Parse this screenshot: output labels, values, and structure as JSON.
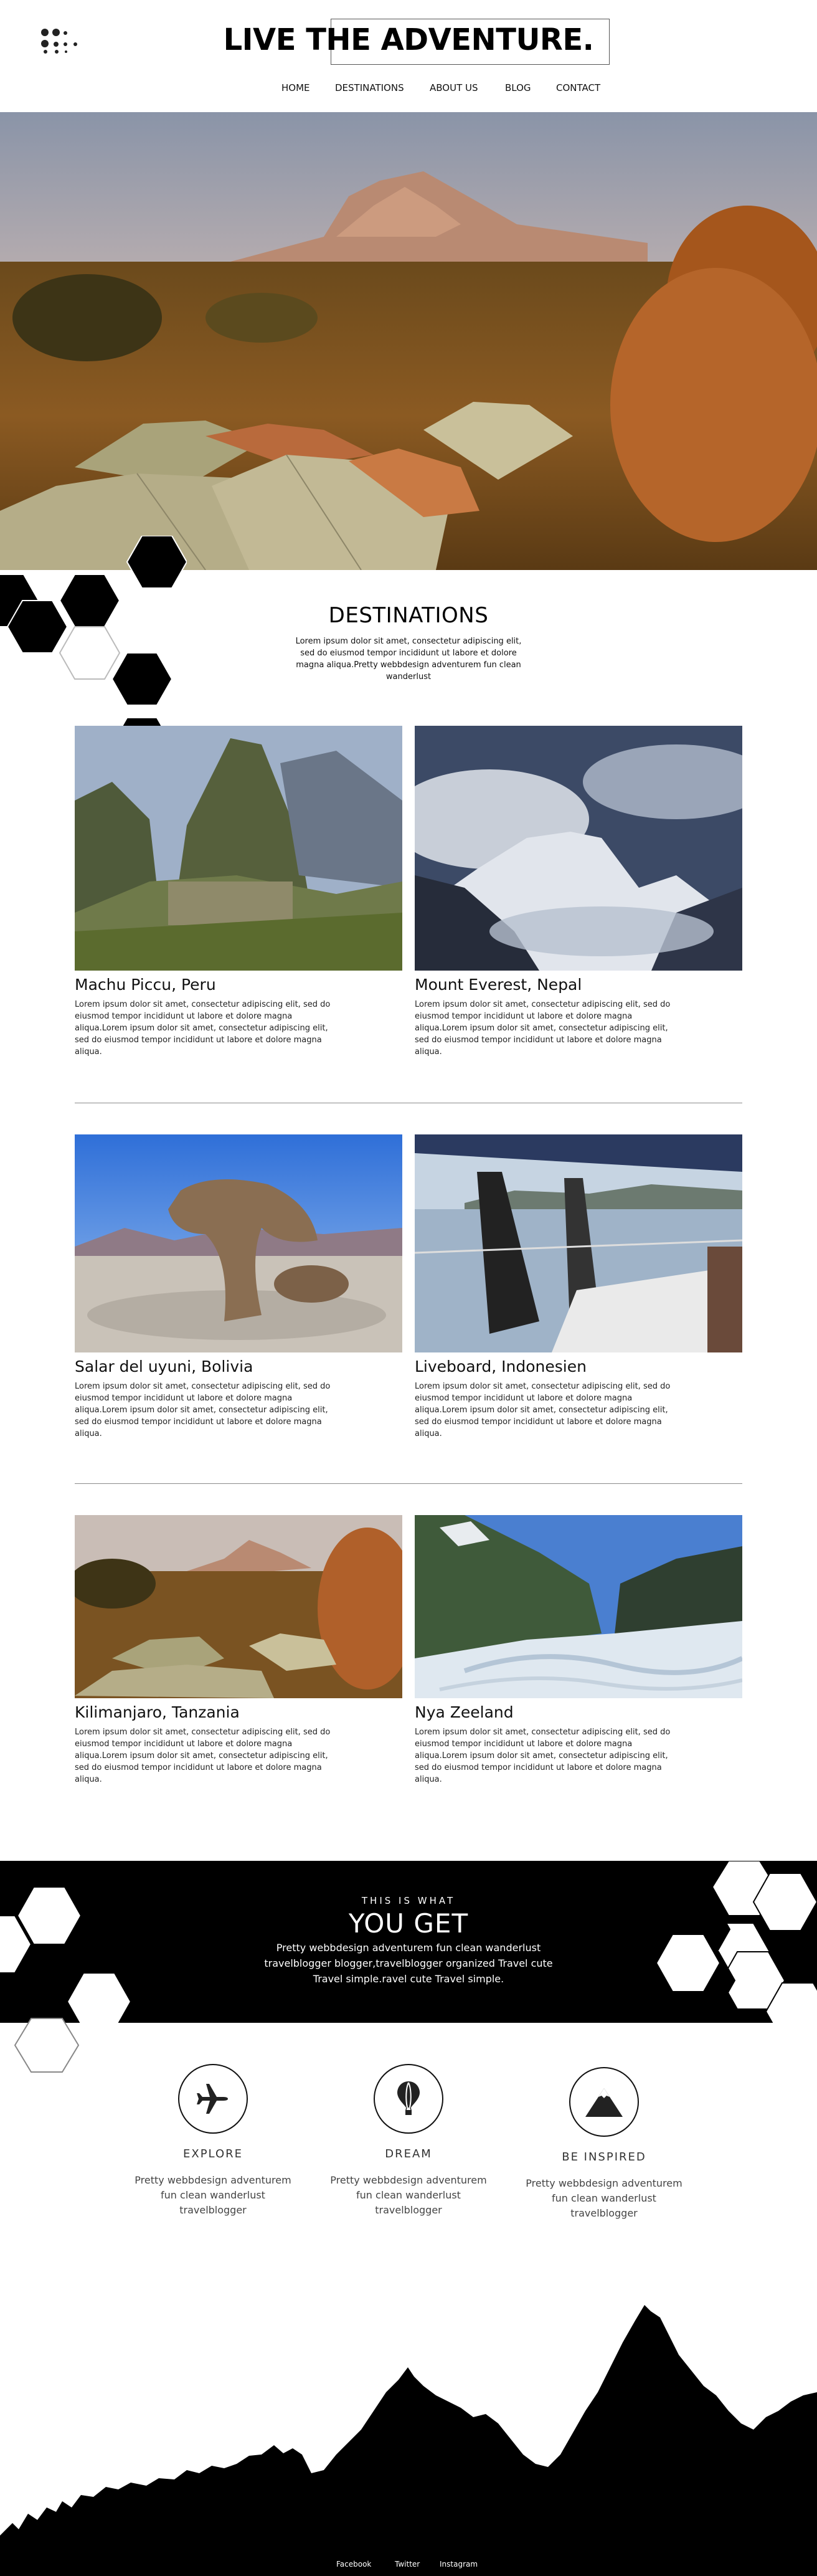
{
  "header": {
    "title": "LIVE THE ADVENTURE.",
    "nav": [
      "HOME",
      "DESTINATIONS",
      "ABOUT US",
      "BLOG",
      "CONTACT"
    ]
  },
  "destinations": {
    "title": "DESTINATIONS",
    "intro": "Lorem ipsum dolor sit amet, consectetur adipiscing elit, sed do eiusmod tempor incididunt ut labore et dolore magna aliqua.Pretty webbdesign adventurem fun clean wanderlust",
    "items": [
      {
        "name": "Machu Piccu, Peru",
        "text": "Lorem ipsum dolor sit amet, consectetur adipiscing elit, sed do eiusmod tempor incididunt ut labore et dolore magna aliqua.Lorem ipsum dolor sit amet, consectetur adipiscing elit, sed do eiusmod tempor incididunt ut labore et dolore magna aliqua."
      },
      {
        "name": "Mount Everest, Nepal",
        "text": "Lorem ipsum dolor sit amet, consectetur adipiscing elit, sed do eiusmod tempor incididunt ut labore et dolore magna aliqua.Lorem ipsum dolor sit amet, consectetur adipiscing elit, sed do eiusmod tempor incididunt ut labore et dolore magna aliqua."
      },
      {
        "name": "Salar del uyuni, Bolivia",
        "text": "Lorem ipsum dolor sit amet, consectetur adipiscing elit, sed do eiusmod tempor incididunt ut labore et dolore magna aliqua.Lorem ipsum dolor sit amet, consectetur adipiscing elit, sed do eiusmod tempor incididunt ut labore et dolore magna aliqua."
      },
      {
        "name": "Liveboard, Indonesien",
        "text": "Lorem ipsum dolor sit amet, consectetur adipiscing elit, sed do eiusmod tempor incididunt ut labore et dolore magna aliqua.Lorem ipsum dolor sit amet, consectetur adipiscing elit, sed do eiusmod tempor incididunt ut labore et dolore magna aliqua."
      },
      {
        "name": "Kilimanjaro, Tanzania",
        "text": "Lorem ipsum dolor sit amet, consectetur adipiscing elit, sed do eiusmod tempor incididunt ut labore et dolore magna aliqua.Lorem ipsum dolor sit amet, consectetur adipiscing elit, sed do eiusmod tempor incididunt ut labore et dolore magna aliqua."
      },
      {
        "name": "Nya Zeeland",
        "text": "Lorem ipsum dolor sit amet, consectetur adipiscing elit, sed do eiusmod tempor incididunt ut labore et dolore magna aliqua.Lorem ipsum dolor sit amet, consectetur adipiscing elit, sed do eiusmod tempor incididunt ut labore et dolore magna aliqua."
      }
    ]
  },
  "get": {
    "kicker": "THIS IS WHAT",
    "title": "YOU GET",
    "text": "Pretty webbdesign adventurem fun clean wanderlust travelblogger blogger,travelblogger organized Travel cute Travel simple.ravel cute Travel simple."
  },
  "features": [
    {
      "icon": "airplane-icon",
      "title": "EXPLORE",
      "text": "Pretty webbdesign adventurem fun clean wanderlust travelblogger"
    },
    {
      "icon": "balloon-icon",
      "title": "DREAM",
      "text": "Pretty webbdesign adventurem fun clean wanderlust travelblogger"
    },
    {
      "icon": "mountain-icon",
      "title": "BE INSPIRED",
      "text": "Pretty webbdesign adventurem fun clean wanderlust travelblogger"
    }
  ],
  "footer": {
    "links": [
      "Facebook",
      "Twitter",
      "Instagram"
    ]
  },
  "colors": {
    "background": "#ffffff",
    "band": "#000000",
    "text": "#111111"
  }
}
